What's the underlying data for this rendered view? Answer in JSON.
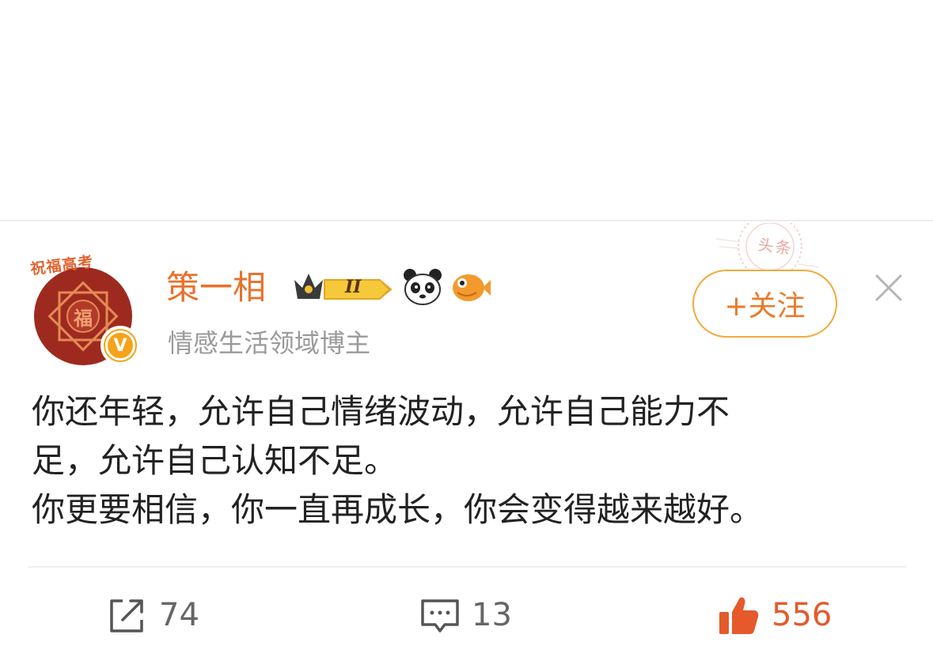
{
  "post": {
    "author": {
      "name": "策一相",
      "avatar_label": "祝福高考",
      "avatar_glyph": "福",
      "verified_mark": "V",
      "bio": "情感生活领域博主",
      "level_badge": "II",
      "badges": [
        "crown-level-icon",
        "panda-icon",
        "fish-icon"
      ]
    },
    "stamp_text": "头条",
    "follow_label": "+关注",
    "content_lines": [
      "你还年轻，允许自己情绪波动，允许自己能力不",
      "足，允许自己认知不足。",
      "你更要相信，你一直再成长，你会变得越来越好。"
    ],
    "actions": {
      "share_count": "74",
      "comment_count": "13",
      "like_count": "556"
    }
  },
  "colors": {
    "accent": "#e8722c",
    "follow_border": "#f2a93b",
    "like": "#e5592b",
    "verify": "#f5a31a",
    "avatar_red": "#9e2a1f"
  }
}
